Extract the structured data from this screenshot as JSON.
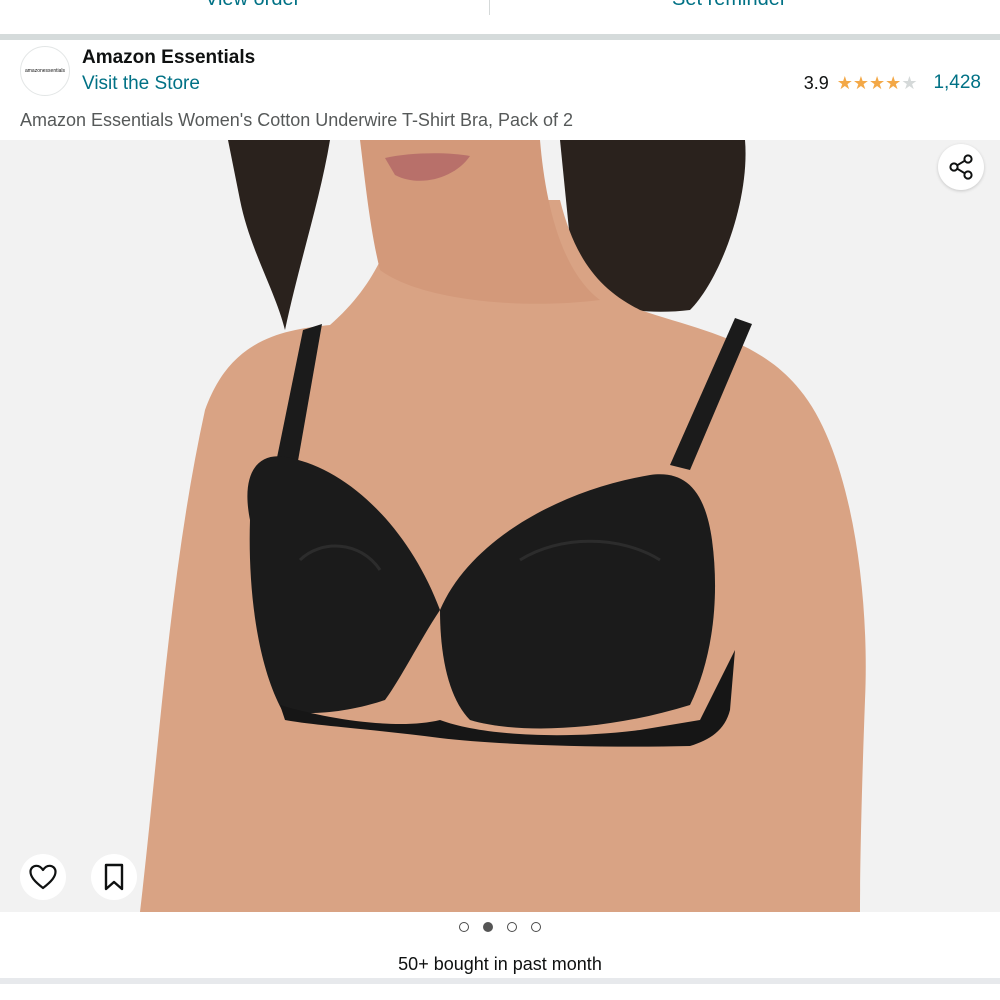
{
  "top_actions": {
    "view_order": "View order",
    "set_reminder": "Set reminder"
  },
  "store": {
    "logo_text": "amazonessentials",
    "name": "Amazon Essentials",
    "visit_label": "Visit the Store"
  },
  "rating": {
    "value": "3.9",
    "stars_filled": 4,
    "stars_total": 5,
    "count": "1,428"
  },
  "product": {
    "title": "Amazon Essentials Women's Cotton Underwire T-Shirt Bra, Pack of 2",
    "image_description_icon": "product-photo"
  },
  "carousel": {
    "dots": 4,
    "active_index": 1
  },
  "social_proof": "50+ bought in past month",
  "colors": {
    "link": "#007185",
    "star": "#f3a847",
    "image_bg": "#f2f2f2",
    "skin": "#d9a384",
    "garment": "#1b1b1b",
    "hair": "#2a221d"
  }
}
